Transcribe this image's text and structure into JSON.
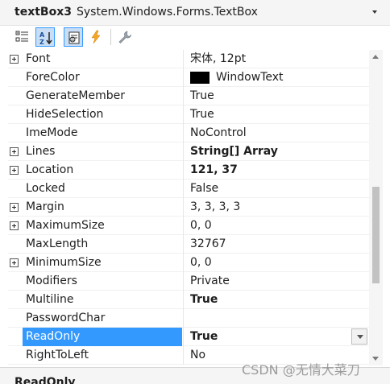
{
  "object_selector": {
    "name": "textBox3",
    "type": "System.Windows.Forms.TextBox"
  },
  "toolbar": {
    "buttons": [
      {
        "name": "categorized-icon",
        "checked": false
      },
      {
        "name": "alphabetical-icon",
        "checked": true
      },
      {
        "name": "properties-icon",
        "checked": true
      },
      {
        "name": "events-icon",
        "checked": false
      },
      {
        "name": "property-pages-icon",
        "checked": false
      }
    ]
  },
  "properties": [
    {
      "name": "Font",
      "value": "宋体, 12pt",
      "expandable": true,
      "bold": false
    },
    {
      "name": "ForeColor",
      "value": "WindowText",
      "expandable": false,
      "bold": false,
      "swatch": "#000000"
    },
    {
      "name": "GenerateMember",
      "value": "True",
      "expandable": false,
      "bold": false
    },
    {
      "name": "HideSelection",
      "value": "True",
      "expandable": false,
      "bold": false
    },
    {
      "name": "ImeMode",
      "value": "NoControl",
      "expandable": false,
      "bold": false
    },
    {
      "name": "Lines",
      "value": "String[] Array",
      "expandable": true,
      "bold": true
    },
    {
      "name": "Location",
      "value": "121, 37",
      "expandable": true,
      "bold": true
    },
    {
      "name": "Locked",
      "value": "False",
      "expandable": false,
      "bold": false
    },
    {
      "name": "Margin",
      "value": "3, 3, 3, 3",
      "expandable": true,
      "bold": false
    },
    {
      "name": "MaximumSize",
      "value": "0, 0",
      "expandable": true,
      "bold": false
    },
    {
      "name": "MaxLength",
      "value": "32767",
      "expandable": false,
      "bold": false
    },
    {
      "name": "MinimumSize",
      "value": "0, 0",
      "expandable": true,
      "bold": false
    },
    {
      "name": "Modifiers",
      "value": "Private",
      "expandable": false,
      "bold": false
    },
    {
      "name": "Multiline",
      "value": "True",
      "expandable": false,
      "bold": true
    },
    {
      "name": "PasswordChar",
      "value": "",
      "expandable": false,
      "bold": false
    },
    {
      "name": "ReadOnly",
      "value": "True",
      "expandable": false,
      "bold": true,
      "selected": true
    },
    {
      "name": "RightToLeft",
      "value": "No",
      "expandable": false,
      "bold": false
    }
  ],
  "description": {
    "title": "ReadOnly"
  },
  "watermark": "CSDN @无情大菜刀",
  "colors": {
    "selection": "#3399ff",
    "toolbar_checked": "#c9def5"
  }
}
